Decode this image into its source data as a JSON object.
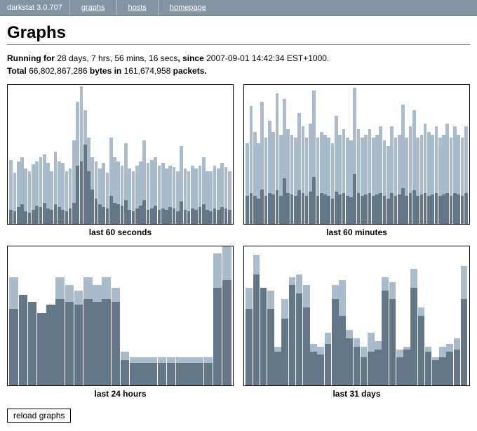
{
  "nav": {
    "brand": "darkstat 3.0.707",
    "links": [
      "graphs",
      "hosts",
      "homepage"
    ]
  },
  "page": {
    "title": "Graphs",
    "running_prefix": "Running for",
    "running_duration": "28 days, 7 hrs, 56 mins, 16 secs",
    "running_since_label": ", since",
    "running_since": "2007-09-01 14:42:34 EST+1000.",
    "total_label": "Total",
    "total_bytes": "66,802,867,286",
    "bytes_in_label": "bytes in",
    "total_packets": "161,674,958",
    "packets_label": "packets."
  },
  "buttons": {
    "reload": "reload graphs"
  },
  "chart_data": [
    {
      "type": "bar",
      "title": "last 60 seconds",
      "ylim": [
        0,
        100
      ],
      "series": [
        {
          "name": "dark",
          "values": [
            10,
            9,
            12,
            14,
            9,
            8,
            10,
            13,
            12,
            15,
            11,
            10,
            14,
            12,
            10,
            9,
            11,
            15,
            42,
            45,
            57,
            38,
            25,
            18,
            14,
            12,
            11,
            20,
            15,
            14,
            13,
            17,
            10,
            9,
            11,
            13,
            17,
            10,
            11,
            13,
            10,
            11,
            10,
            12,
            11,
            9,
            16,
            10,
            9,
            11,
            10,
            12,
            14,
            10,
            9,
            11,
            10,
            12,
            11,
            10
          ]
        },
        {
          "name": "light",
          "values": [
            46,
            37,
            45,
            48,
            40,
            38,
            43,
            45,
            48,
            50,
            44,
            38,
            52,
            45,
            44,
            38,
            40,
            60,
            88,
            99,
            82,
            62,
            48,
            45,
            40,
            44,
            37,
            62,
            48,
            45,
            42,
            58,
            40,
            38,
            42,
            45,
            60,
            44,
            46,
            48,
            42,
            44,
            40,
            42,
            41,
            38,
            56,
            40,
            38,
            42,
            40,
            42,
            48,
            38,
            38,
            42,
            40,
            44,
            41,
            38
          ]
        }
      ]
    },
    {
      "type": "bar",
      "title": "last 60 minutes",
      "ylim": [
        0,
        100
      ],
      "series": [
        {
          "name": "dark",
          "values": [
            20,
            22,
            20,
            18,
            25,
            20,
            22,
            21,
            24,
            20,
            33,
            22,
            21,
            20,
            24,
            22,
            20,
            23,
            34,
            20,
            22,
            21,
            20,
            18,
            23,
            21,
            22,
            20,
            19,
            36,
            22,
            20,
            21,
            22,
            20,
            21,
            22,
            20,
            18,
            22,
            20,
            21,
            26,
            20,
            22,
            24,
            20,
            21,
            22,
            20,
            21,
            22,
            20,
            21,
            22,
            20,
            22,
            21,
            20,
            22
          ]
        },
        {
          "name": "light",
          "values": [
            58,
            85,
            66,
            58,
            88,
            62,
            74,
            66,
            94,
            64,
            90,
            68,
            64,
            62,
            80,
            70,
            62,
            72,
            96,
            62,
            66,
            64,
            62,
            58,
            78,
            64,
            68,
            62,
            60,
            98,
            68,
            62,
            64,
            68,
            62,
            64,
            70,
            60,
            56,
            70,
            62,
            64,
            86,
            62,
            70,
            82,
            62,
            64,
            72,
            66,
            64,
            70,
            62,
            64,
            72,
            62,
            70,
            64,
            62,
            70
          ]
        }
      ]
    },
    {
      "type": "bar",
      "title": "last 24 hours",
      "ylim": [
        0,
        100
      ],
      "series": [
        {
          "name": "dark",
          "values": [
            55,
            65,
            60,
            52,
            58,
            62,
            60,
            58,
            62,
            60,
            62,
            60,
            18,
            16,
            16,
            16,
            16,
            16,
            16,
            16,
            16,
            16,
            70,
            76
          ]
        },
        {
          "name": "light",
          "values": [
            78,
            65,
            60,
            52,
            58,
            78,
            72,
            68,
            78,
            72,
            78,
            70,
            24,
            20,
            20,
            20,
            20,
            20,
            20,
            20,
            20,
            20,
            95,
            100
          ]
        }
      ]
    },
    {
      "type": "bar",
      "title": "last 31 days",
      "ylim": [
        0,
        100
      ],
      "series": [
        {
          "name": "dark",
          "values": [
            55,
            80,
            70,
            55,
            24,
            48,
            72,
            66,
            56,
            24,
            22,
            30,
            62,
            50,
            34,
            28,
            20,
            24,
            26,
            68,
            62,
            20,
            26,
            70,
            50,
            24,
            18,
            20,
            24,
            26,
            62
          ]
        },
        {
          "name": "light",
          "values": [
            70,
            94,
            70,
            68,
            28,
            62,
            78,
            80,
            72,
            30,
            28,
            38,
            72,
            76,
            40,
            34,
            28,
            38,
            32,
            78,
            74,
            26,
            28,
            84,
            56,
            28,
            20,
            28,
            30,
            34,
            86
          ]
        }
      ]
    }
  ]
}
